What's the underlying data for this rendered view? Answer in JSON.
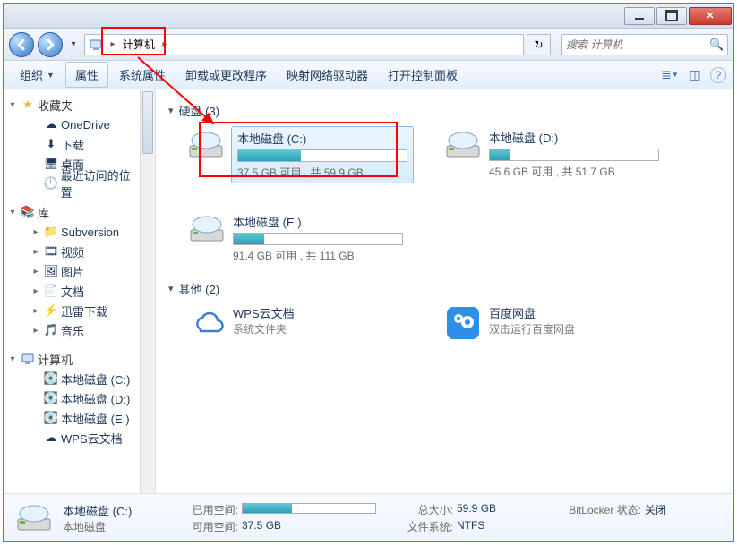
{
  "window": {
    "address_label": "计算机",
    "search_placeholder": "搜索 计算机"
  },
  "toolbar": {
    "organize": "组织",
    "properties": "属性",
    "sys_props": "系统属性",
    "uninstall": "卸载或更改程序",
    "map_drive": "映射网络驱动器",
    "control_panel": "打开控制面板"
  },
  "sidebar": {
    "favorites": "收藏夹",
    "fav_items": [
      {
        "icon": "☁",
        "label": "OneDrive"
      },
      {
        "icon": "⬇",
        "label": "下载"
      },
      {
        "icon": "🖥",
        "label": "桌面"
      },
      {
        "icon": "🕘",
        "label": "最近访问的位置"
      }
    ],
    "libraries": "库",
    "lib_items": [
      {
        "icon": "📁",
        "label": "Subversion"
      },
      {
        "icon": "🎞",
        "label": "视频"
      },
      {
        "icon": "🖼",
        "label": "图片"
      },
      {
        "icon": "📄",
        "label": "文档"
      },
      {
        "icon": "⚡",
        "label": "迅雷下载"
      },
      {
        "icon": "🎵",
        "label": "音乐"
      }
    ],
    "computer": "计算机",
    "comp_items": [
      {
        "icon": "💽",
        "label": "本地磁盘 (C:)"
      },
      {
        "icon": "💽",
        "label": "本地磁盘 (D:)"
      },
      {
        "icon": "💽",
        "label": "本地磁盘 (E:)"
      },
      {
        "icon": "☁",
        "label": "WPS云文档"
      }
    ]
  },
  "content": {
    "hdd_header": "硬盘 (3)",
    "other_header": "其他 (2)",
    "drives": [
      {
        "name": "本地磁盘 (C:)",
        "free": "37.5 GB 可用 , 共 59.9 GB",
        "pct": 37,
        "selected": true
      },
      {
        "name": "本地磁盘 (D:)",
        "free": "45.6 GB 可用 , 共 51.7 GB",
        "pct": 12,
        "selected": false
      },
      {
        "name": "本地磁盘 (E:)",
        "free": "91.4 GB 可用 , 共 111 GB",
        "pct": 18,
        "selected": false
      }
    ],
    "others": [
      {
        "name": "WPS云文档",
        "desc": "系统文件夹",
        "icon": "cloud"
      },
      {
        "name": "百度网盘",
        "desc": "双击运行百度网盘",
        "icon": "baidu"
      }
    ]
  },
  "details": {
    "name": "本地磁盘 (C:)",
    "type": "本地磁盘",
    "used_label": "已用空间:",
    "free_label": "可用空间:",
    "size_label": "总大小:",
    "fs_label": "文件系统:",
    "bitlocker_label": "BitLocker 状态:",
    "free_val": "37.5 GB",
    "size_val": "59.9 GB",
    "fs_val": "NTFS",
    "bitlocker_val": "关闭",
    "used_pct": 37
  }
}
